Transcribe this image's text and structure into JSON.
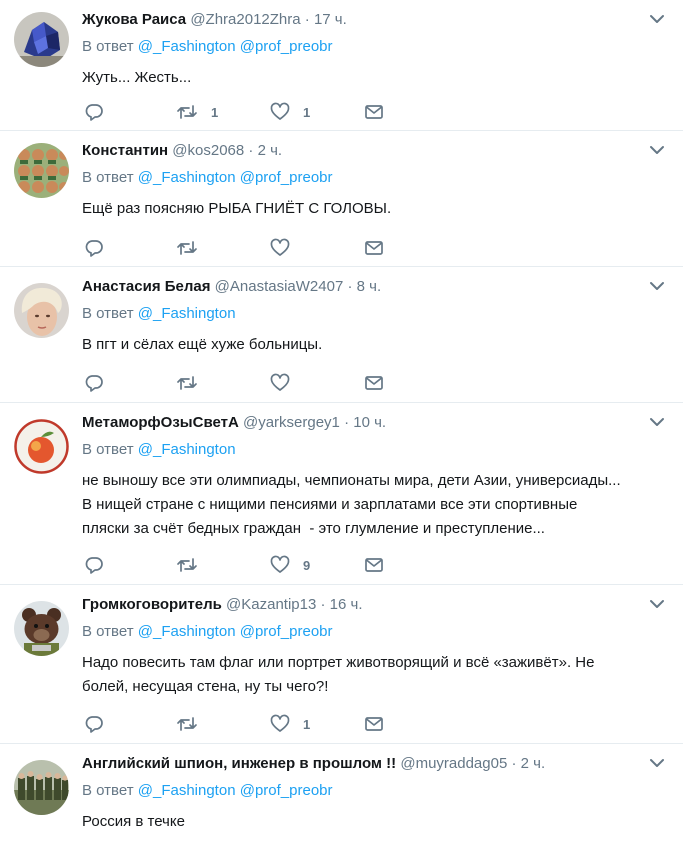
{
  "tweets": [
    {
      "name": "Жукова Раиса",
      "handle": "@Zhra2012Zhra",
      "time": "17 ч.",
      "reply_label": "В ответ",
      "mentions": [
        "@_Fashington",
        "@prof_preobr"
      ],
      "text": [
        "Жуть... Жесть..."
      ],
      "retweets": "1",
      "likes": "1",
      "avatar": "sapphire-rock-avatar"
    },
    {
      "name": "Константин",
      "handle": "@kos2068",
      "time": "2 ч.",
      "reply_label": "В ответ",
      "mentions": [
        "@_Fashington",
        "@prof_preobr"
      ],
      "text": [
        "Ещё раз поясняю РЫБА ГНИЁТ С ГОЛОВЫ."
      ],
      "retweets": "",
      "likes": "",
      "avatar": "fish-grid-avatar"
    },
    {
      "name": "Анастасия Белая",
      "handle": "@AnastasiaW2407",
      "time": "8 ч.",
      "reply_label": "В ответ",
      "mentions": [
        "@_Fashington"
      ],
      "text": [
        "В пгт и сёлах ещё хуже больницы."
      ],
      "retweets": "",
      "likes": "",
      "avatar": "blonde-woman-avatar"
    },
    {
      "name": "МетаморфОзыСветА",
      "handle": "@yarksergey1",
      "time": "10 ч.",
      "reply_label": "В ответ",
      "mentions": [
        "@_Fashington"
      ],
      "text": [
        "не выношу все эти олимпиады, чемпионаты мира, дети Азии, универсиады...",
        "В нищей стране с нищими пенсиями и зарплатами все эти спортивные",
        "пляски за счёт бедных граждан  - это глумление и преступление..."
      ],
      "retweets": "",
      "likes": "9",
      "avatar": "apple-avatar"
    },
    {
      "name": "Громкоговоритель",
      "handle": "@Kazantip13",
      "time": "16 ч.",
      "reply_label": "В ответ",
      "mentions": [
        "@_Fashington",
        "@prof_preobr"
      ],
      "text": [
        "Надо повесить там флаг или портрет животворящий и всё «заживёт». Не",
        "болей, несущая стена, ну ты чего?!"
      ],
      "retweets": "",
      "likes": "1",
      "avatar": "bear-avatar"
    },
    {
      "name": "Английский шпион, инженер в прошлом !!",
      "handle": "@muyraddag05",
      "time": "2 ч.",
      "reply_label": "В ответ",
      "mentions": [
        "@_Fashington",
        "@prof_preobr"
      ],
      "text": [
        "Россия в течке"
      ],
      "retweets": "",
      "likes": "",
      "avatar": "soldiers-group-avatar"
    }
  ],
  "separator_dot": "·",
  "colors": {
    "link": "#1da1f2",
    "muted": "#657786",
    "text": "#14171a",
    "border": "#e6ecf0"
  },
  "icons": [
    "reply-icon",
    "retweet-icon",
    "like-icon",
    "direct-message-icon",
    "chevron-down-icon"
  ]
}
